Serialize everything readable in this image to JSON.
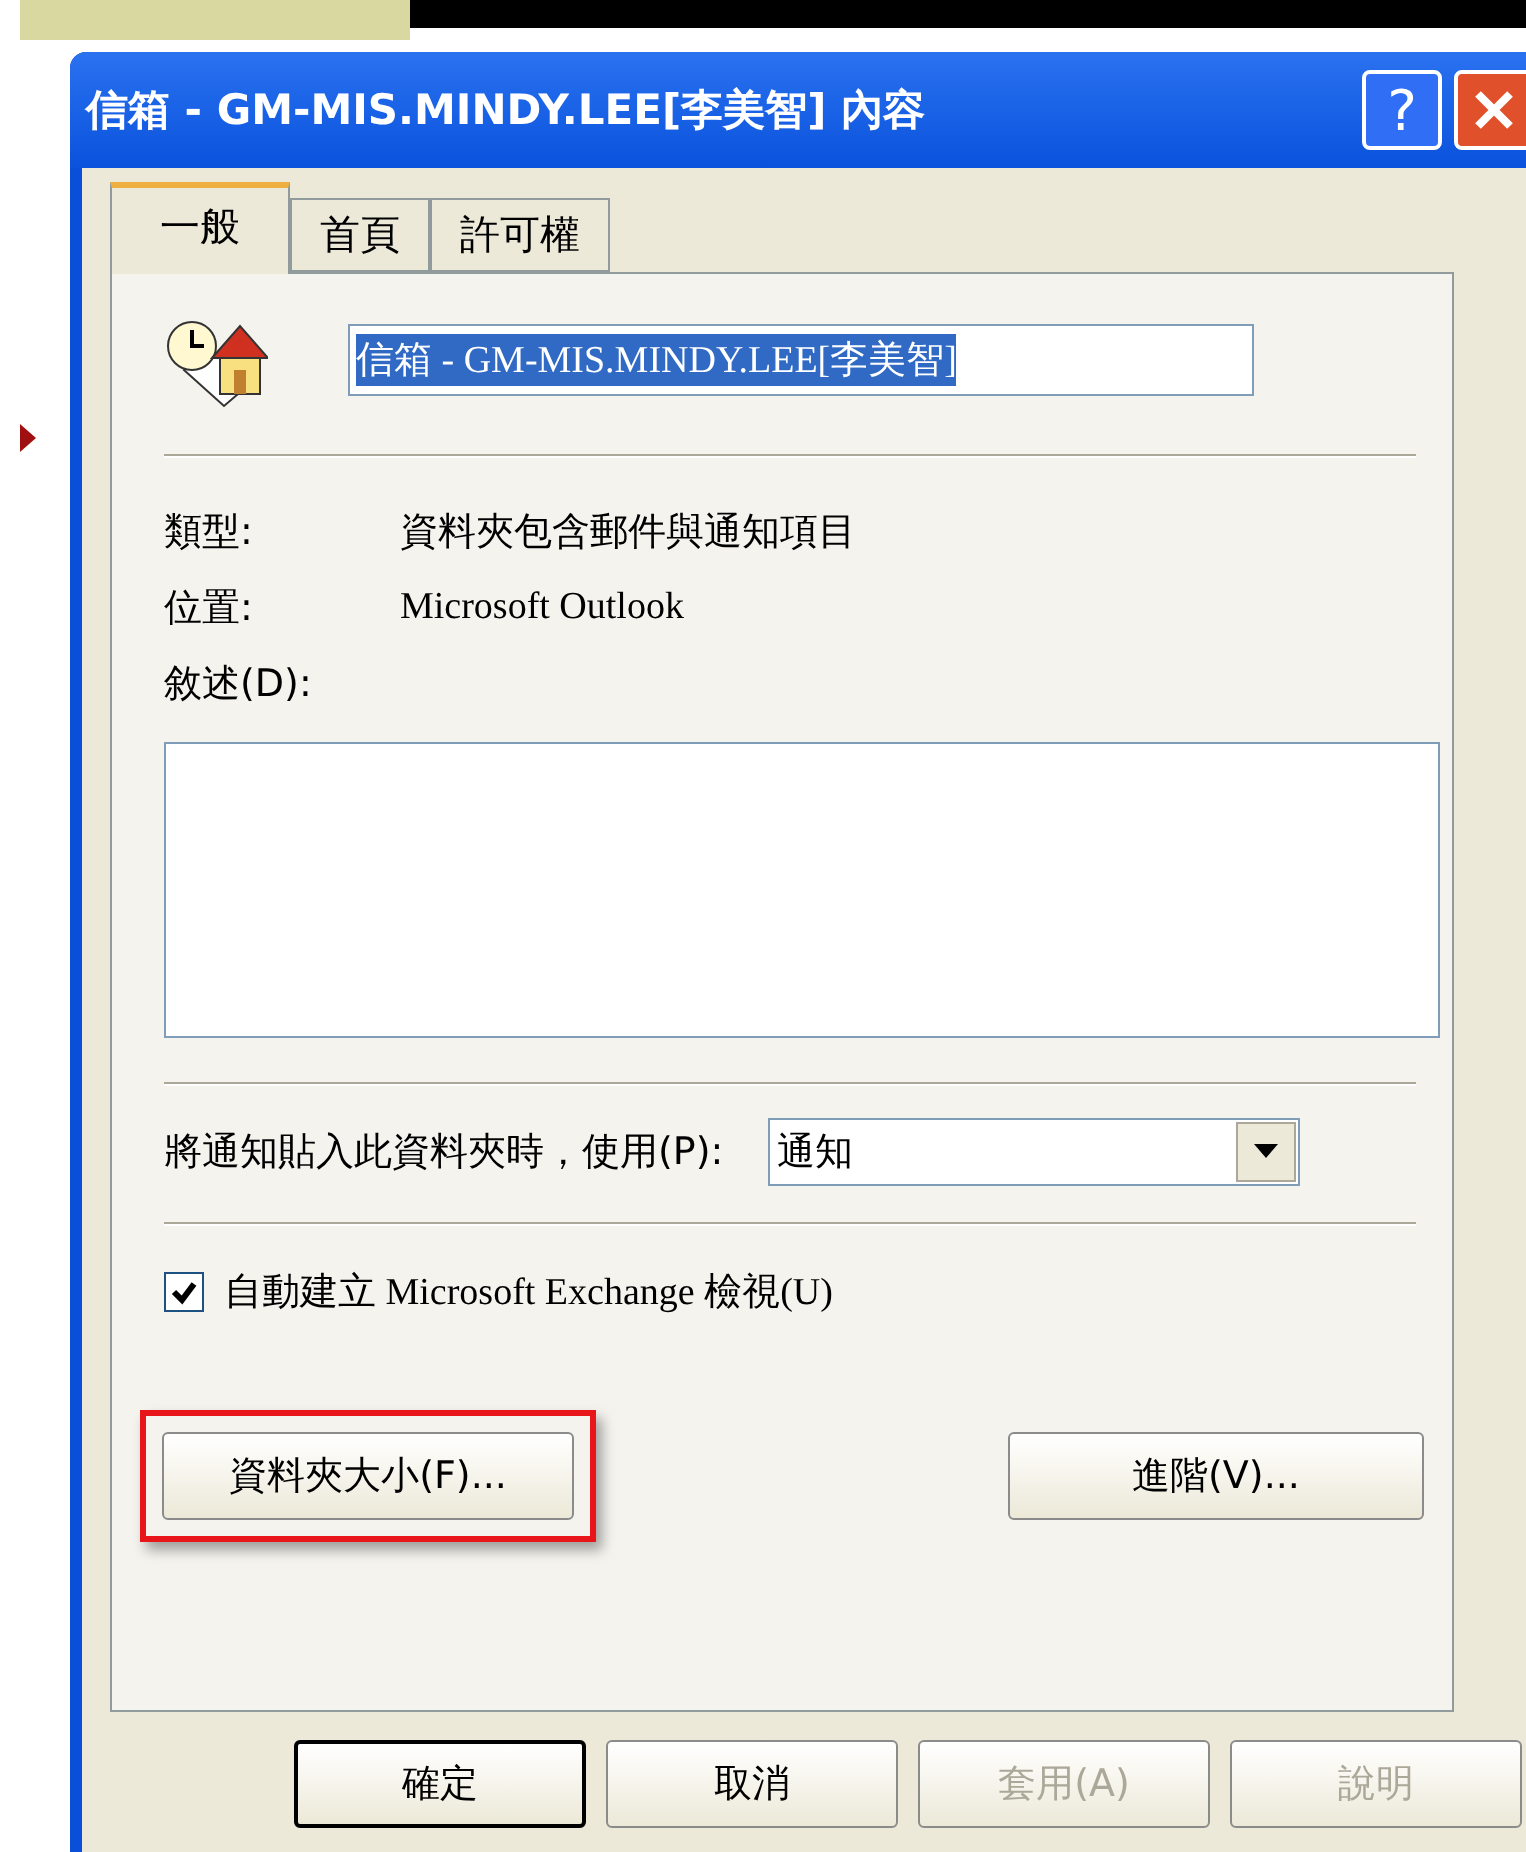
{
  "window": {
    "title": "信箱 - GM-MIS.MINDY.LEE[李美智] 內容",
    "help_button": "?"
  },
  "tabs": [
    {
      "label": "一般",
      "selected": true
    },
    {
      "label": "首頁",
      "selected": false
    },
    {
      "label": "許可權",
      "selected": false
    }
  ],
  "name_field": {
    "value": "信箱 - GM-MIS.MINDY.LEE[李美智]",
    "highlighted": true
  },
  "properties": [
    {
      "label": "類型:",
      "value": "資料夾包含郵件與通知項目"
    },
    {
      "label": "位置:",
      "value": "Microsoft Outlook"
    }
  ],
  "description": {
    "label": "敘述(D):"
  },
  "post_form": {
    "label": "將通知貼入此資料夾時，使用(P):",
    "value": "通知"
  },
  "auto_view": {
    "label": "自動建立 Microsoft Exchange 檢視(U)",
    "checked": true
  },
  "folder_size_button": {
    "label": "資料夾大小(F)...",
    "highlighted": true
  },
  "advanced_button": {
    "label": "進階(V)..."
  },
  "buttons": [
    {
      "label": "確定",
      "default": true,
      "disabled": false
    },
    {
      "label": "取消",
      "default": false,
      "disabled": false
    },
    {
      "label": "套用(A)",
      "default": false,
      "disabled": true
    },
    {
      "label": "說明",
      "default": false,
      "disabled": true
    }
  ]
}
